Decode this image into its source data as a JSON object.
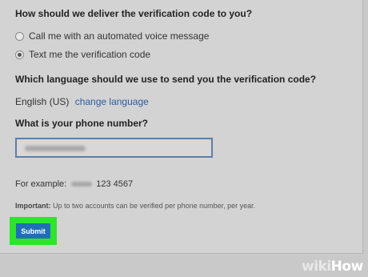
{
  "form": {
    "delivery_question": "How should we deliver the verification code to you?",
    "delivery_options": [
      {
        "label": "Call me with an automated voice message",
        "selected": false
      },
      {
        "label": "Text me the verification code",
        "selected": true
      }
    ],
    "language_question": "Which language should we use to send you the verification code?",
    "language_value": "English (US)",
    "change_language_link": "change language",
    "phone_question": "What is your phone number?",
    "example_prefix": "For example:",
    "example_number": "123 4567",
    "important_label": "Important:",
    "important_text": " Up to two accounts can be verified per phone number, per year.",
    "submit_label": "Submit"
  },
  "watermark": {
    "part1": "wiki",
    "part2": "How"
  },
  "colors": {
    "accent_link": "#2e5b9e",
    "submit": "#1f6fb5",
    "highlight": "#2de52d"
  }
}
